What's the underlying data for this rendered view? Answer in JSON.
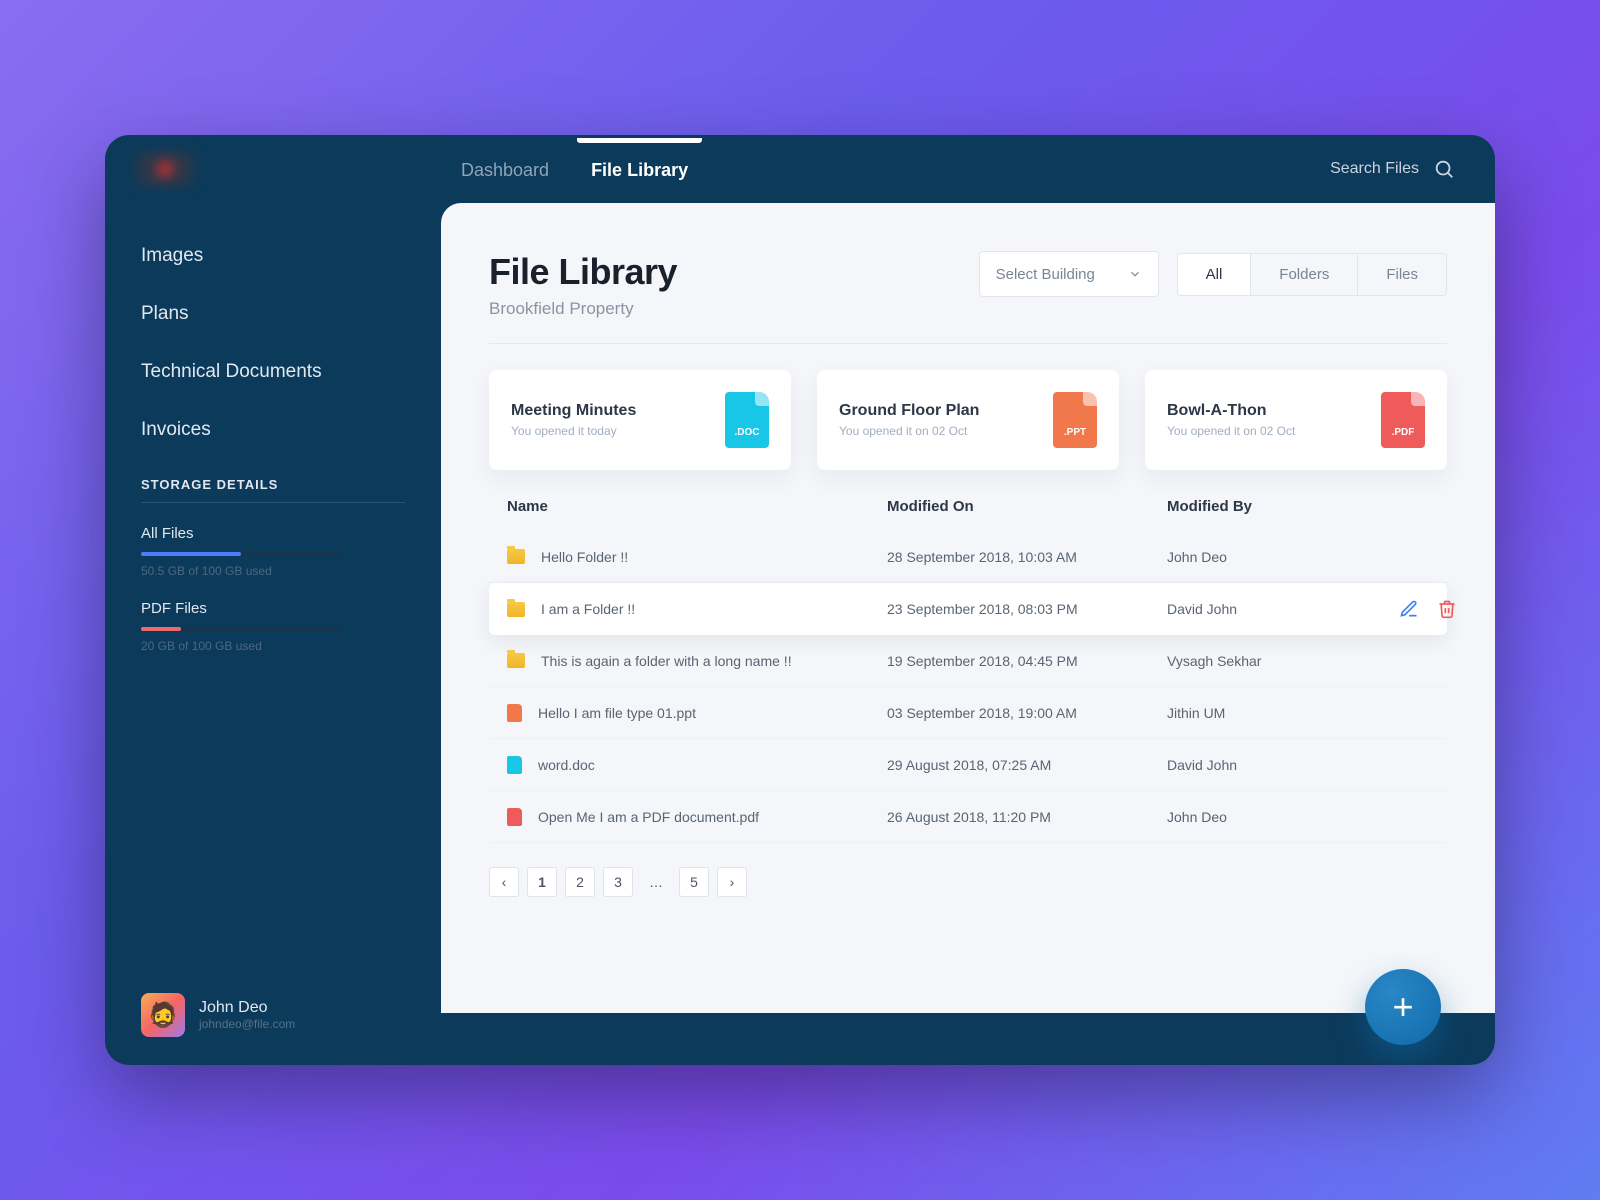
{
  "header": {
    "tabs": [
      "Dashboard",
      "File Library"
    ],
    "active_tab": 1,
    "search_label": "Search Files"
  },
  "sidebar": {
    "nav": [
      "Images",
      "Plans",
      "Technical Documents",
      "Invoices"
    ],
    "storage_title": "STORAGE DETAILS",
    "blocks": [
      {
        "label": "All Files",
        "used_text": "50.5 GB of 100 GB used",
        "pct": 50,
        "color": "#4f7df5"
      },
      {
        "label": "PDF Files",
        "used_text": "20 GB of 100 GB used",
        "pct": 20,
        "color": "#ef6a6a"
      }
    ],
    "user": {
      "name": "John Deo",
      "email": "johndeo@file.com"
    }
  },
  "page": {
    "title": "File Library",
    "subtitle": "Brookfield Property",
    "select_label": "Select Building",
    "segments": [
      "All",
      "Folders",
      "Files"
    ],
    "active_segment": 0
  },
  "recent": [
    {
      "title": "Meeting Minutes",
      "sub": "You opened it today",
      "ext": ".DOC",
      "color": "#18c6e6"
    },
    {
      "title": "Ground Floor Plan",
      "sub": "You opened it on 02 Oct",
      "ext": ".PPT",
      "color": "#f0784b"
    },
    {
      "title": "Bowl-A-Thon",
      "sub": "You opened it on 02 Oct",
      "ext": ".PDF",
      "color": "#ef5b5b"
    }
  ],
  "table": {
    "cols": [
      "Name",
      "Modified On",
      "Modified By"
    ],
    "rows": [
      {
        "type": "folder",
        "name": "Hello Folder !!",
        "modified": "28 September 2018, 10:03 AM",
        "by": "John Deo"
      },
      {
        "type": "folder",
        "name": "I am a Folder !!",
        "modified": "23 September 2018, 08:03 PM",
        "by": "David John",
        "selected": true
      },
      {
        "type": "folder",
        "name": "This is again a folder with a long name !!",
        "modified": "19 September 2018, 04:45 PM",
        "by": "Vysagh Sekhar"
      },
      {
        "type": "ppt",
        "name": "Hello I am file type 01.ppt",
        "modified": "03 September 2018, 19:00 AM",
        "by": "Jithin UM"
      },
      {
        "type": "doc",
        "name": "word.doc",
        "modified": "29 August 2018, 07:25 AM",
        "by": "David John"
      },
      {
        "type": "pdf",
        "name": "Open Me I am a PDF document.pdf",
        "modified": "26 August 2018, 11:20 PM",
        "by": "John Deo"
      }
    ]
  },
  "pager": {
    "pages": [
      "1",
      "2",
      "3",
      "…",
      "5"
    ],
    "active": 0
  },
  "colors": {
    "ppt": "#f0784b",
    "doc": "#18c6e6",
    "pdf": "#ef5b5b"
  }
}
